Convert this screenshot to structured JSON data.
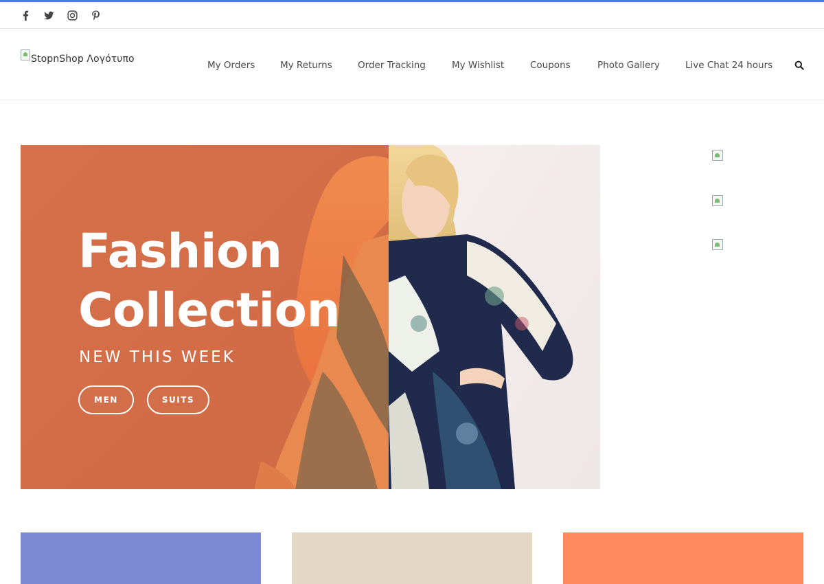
{
  "colors": {
    "accent": "#4a7fd0",
    "hero_orange": "#d9714a",
    "tile_1": "#7c8ad6",
    "tile_2": "#e4d8c4",
    "tile_3": "#fe8a5e"
  },
  "social": [
    {
      "icon": "facebook-icon"
    },
    {
      "icon": "twitter-icon"
    },
    {
      "icon": "instagram-icon"
    },
    {
      "icon": "pinterest-icon"
    }
  ],
  "header": {
    "logo_alt": "StopnShop Λογότυπο",
    "nav": [
      {
        "label": "My Orders"
      },
      {
        "label": "My Returns"
      },
      {
        "label": "Order Tracking"
      },
      {
        "label": "My Wishlist"
      },
      {
        "label": "Coupons"
      },
      {
        "label": "Photo Gallery"
      },
      {
        "label": "Live Chat 24 hours"
      }
    ],
    "search_icon": "search-icon"
  },
  "hero": {
    "title_line1": "Fashion",
    "title_line2": "Collection",
    "subtitle": "NEW THIS WEEK",
    "buttons": [
      {
        "label": "MEN"
      },
      {
        "label": "SUITS"
      }
    ]
  },
  "side_images": [
    {
      "icon": "broken-image-icon"
    },
    {
      "icon": "broken-image-icon"
    },
    {
      "icon": "broken-image-icon"
    }
  ]
}
